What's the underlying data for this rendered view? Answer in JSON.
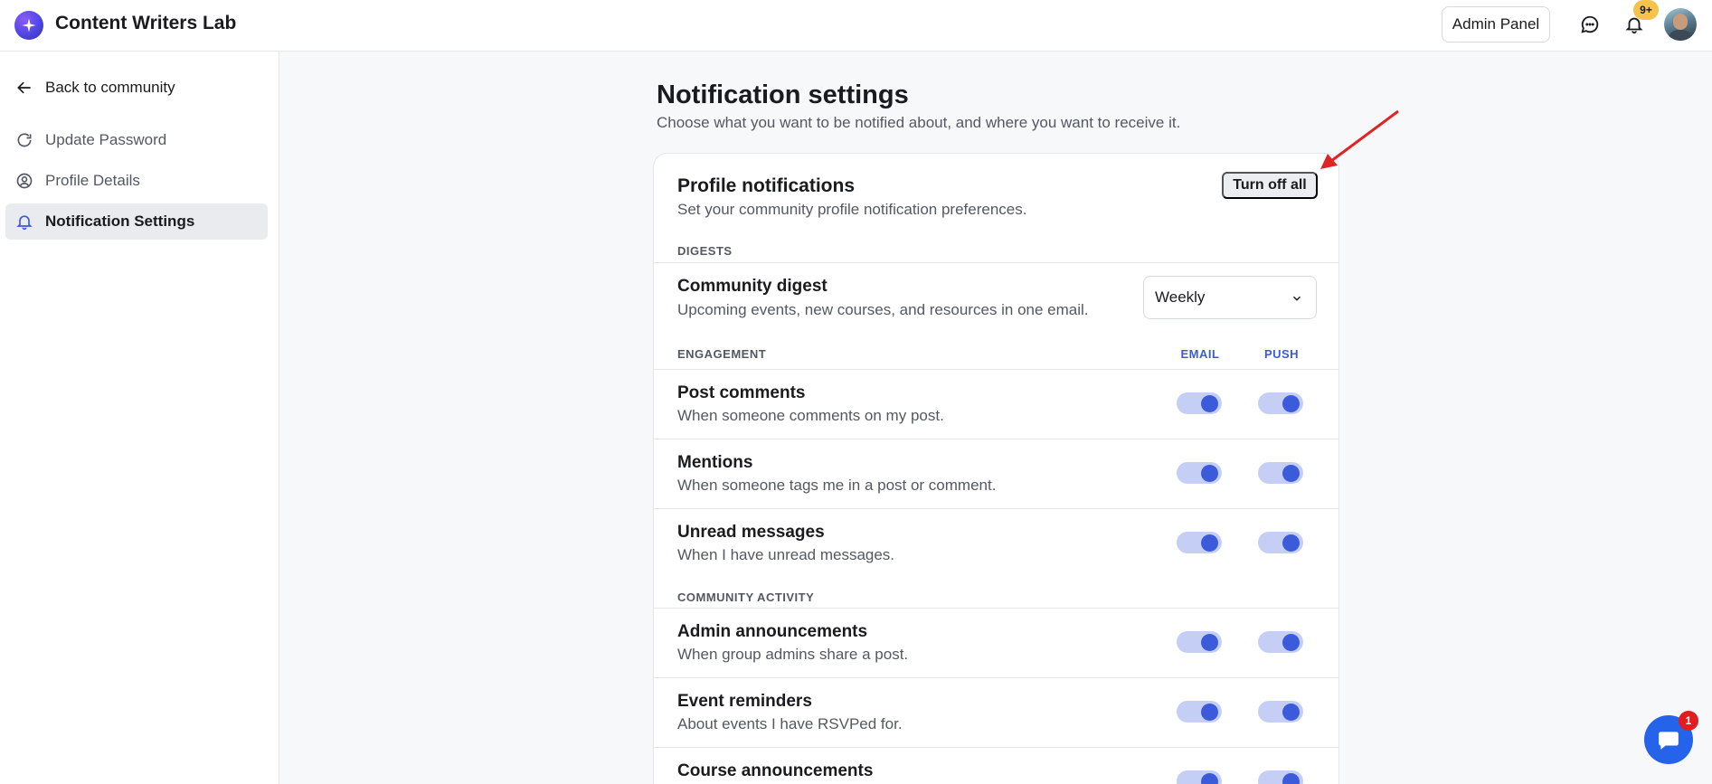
{
  "header": {
    "brand": "Content Writers Lab",
    "admin_label": "Admin Panel",
    "notification_badge": "9+"
  },
  "sidebar": {
    "back_label": "Back to community",
    "items": [
      {
        "label": "Update Password",
        "icon": "refresh-icon"
      },
      {
        "label": "Profile Details",
        "icon": "user-circle-icon"
      },
      {
        "label": "Notification Settings",
        "icon": "bell-icon",
        "active": true
      }
    ]
  },
  "page": {
    "title": "Notification settings",
    "subtitle": "Choose what you want to be notified about, and where you want to receive it."
  },
  "card": {
    "title": "Profile notifications",
    "subtitle": "Set your community profile notification preferences.",
    "turn_off_label": "Turn off all",
    "digests_label": "DIGESTS",
    "digest": {
      "title": "Community digest",
      "desc": "Upcoming events, new courses, and resources in one email.",
      "value": "Weekly"
    },
    "engagement_label": "ENGAGEMENT",
    "email_col": "EMAIL",
    "push_col": "PUSH",
    "community_label": "COMMUNITY ACTIVITY",
    "rows": [
      {
        "title": "Post comments",
        "desc": "When someone comments on my post.",
        "email": true,
        "push": true
      },
      {
        "title": "Mentions",
        "desc": "When someone tags me in a post or comment.",
        "email": true,
        "push": true
      },
      {
        "title": "Unread messages",
        "desc": "When I have unread messages.",
        "email": true,
        "push": true
      },
      {
        "title": "Admin announcements",
        "desc": "When group admins share a post.",
        "email": true,
        "push": true
      },
      {
        "title": "Event reminders",
        "desc": "About events I have RSVPed for.",
        "email": true,
        "push": true
      },
      {
        "title": "Course announcements",
        "desc": "",
        "email": true,
        "push": true
      }
    ]
  },
  "chat": {
    "badge": "1"
  },
  "colors": {
    "accent": "#3b5bdb",
    "toggle_track": "#c5cef5",
    "annotation": "#e02424"
  }
}
